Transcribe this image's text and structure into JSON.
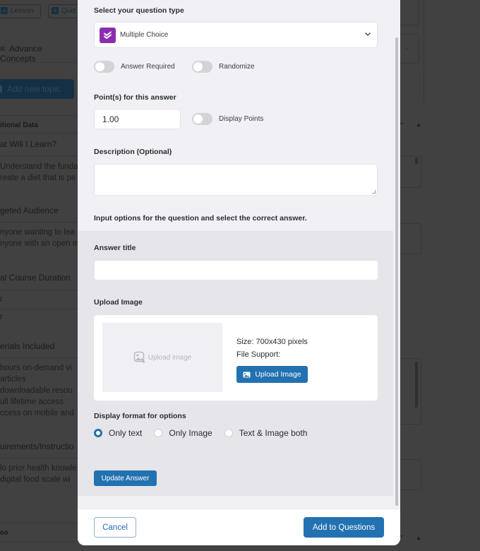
{
  "background": {
    "toolbar_buttons": [
      {
        "label": "Lesson",
        "icon": "plus-square-icon"
      },
      {
        "label": "Quiz",
        "icon": "plus-square-icon"
      }
    ],
    "topic_title": "Advance Concepts",
    "add_topic_label": "Add new topic",
    "section_title": "itional Data",
    "rows": [
      {
        "heading": "at Will I Learn?",
        "lines": [
          "Understand the fundar",
          "reate a diet that is pe"
        ]
      },
      {
        "heading": "geted Audience",
        "lines": [
          "nyone wanting to lea",
          "nyone with an open m"
        ]
      },
      {
        "heading": "al Course Duration",
        "lines": [
          "r",
          "r"
        ]
      },
      {
        "heading": "erials Included",
        "lines": [
          "hours on-demand vi",
          "articles",
          "downloadable resou",
          "ull lifetime access",
          "ccess on mobile and"
        ]
      },
      {
        "heading": "uirements/Instructio",
        "lines": [
          "lo prior health knowle",
          "digital food scale wi"
        ]
      },
      {
        "heading": "eo",
        "lines": []
      }
    ]
  },
  "modal": {
    "question_type": {
      "label": "Select your question type",
      "selected": "Multiple Choice",
      "icon_color": "#8e2cb1"
    },
    "toggles": {
      "answer_required": {
        "label": "Answer Required",
        "on": false
      },
      "randomize": {
        "label": "Randomize",
        "on": false
      },
      "display_points": {
        "label": "Display Points",
        "on": false
      }
    },
    "points": {
      "label": "Point(s) for this answer",
      "value": "1.00"
    },
    "description": {
      "label": "Description (Optional)",
      "value": ""
    },
    "options_instruction": "Input options for the question and select the correct answer.",
    "answer": {
      "title_label": "Answer title",
      "title_value": "",
      "upload_label": "Upload Image",
      "upload_placeholder": "Upload image",
      "size_info": "Size: 700x430 pixels",
      "file_support": "File Support:",
      "upload_button": "Upload Image",
      "display_format_label": "Display format for options",
      "display_formats": [
        {
          "label": "Only text",
          "checked": true
        },
        {
          "label": "Only Image",
          "checked": false
        },
        {
          "label": "Text & Image both",
          "checked": false
        }
      ],
      "update_button": "Update Answer"
    },
    "footer": {
      "cancel_label": "Cancel",
      "add_label": "Add to Questions"
    },
    "accent_color": "#2271b1"
  }
}
